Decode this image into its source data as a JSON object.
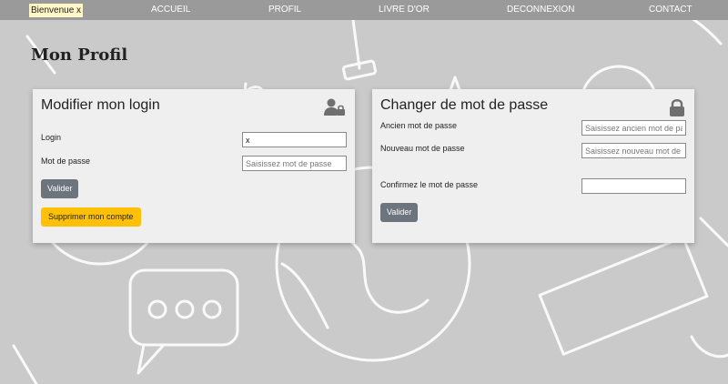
{
  "nav": {
    "welcome": "Bienvenue x",
    "links": [
      "ACCUEIL",
      "PROFIL",
      "LIVRE D'OR",
      "DECONNEXION",
      "CONTACT"
    ]
  },
  "page": {
    "title": "Mon Profil"
  },
  "login_card": {
    "title": "Modifier mon login",
    "icon": "user-lock-icon",
    "login_label": "Login",
    "login_value": "x",
    "password_label": "Mot de passe",
    "password_placeholder": "Saisissez mot de passe",
    "submit_label": "Valider",
    "delete_label": "Supprimer mon compte"
  },
  "password_card": {
    "title": "Changer de mot de passe",
    "icon": "lock-icon",
    "old_label": "Ancien mot de passe",
    "old_placeholder": "Saisissez ancien mot de passe",
    "new_label": "Nouveau mot de passe",
    "new_placeholder": "Saisissez nouveau mot de passe",
    "confirm_label": "Confirmez le mot de passe",
    "confirm_value": "",
    "submit_label": "Valider"
  },
  "colors": {
    "background": "#cacaca",
    "navbar": "#9a9a9a",
    "welcome_highlight": "#fff7c8",
    "card": "#efefef",
    "button_secondary": "#6c757d",
    "button_warning": "#ffc107"
  }
}
